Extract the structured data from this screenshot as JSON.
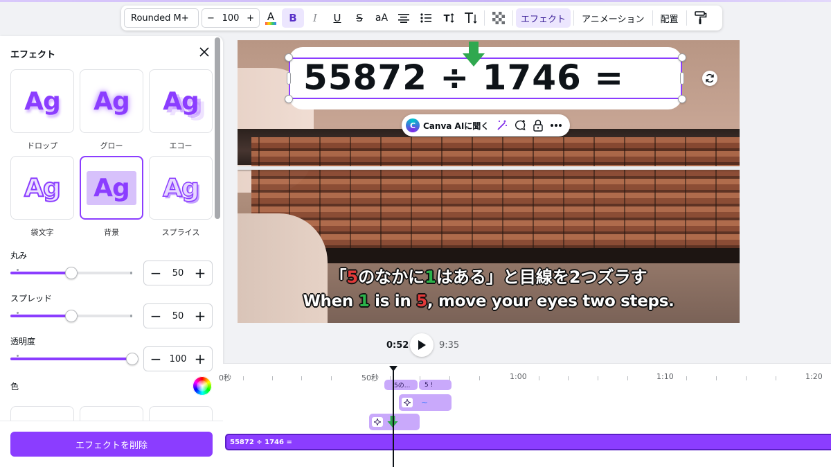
{
  "toolbar": {
    "font_name": "Rounded M+",
    "font_size": "100",
    "minus": "−",
    "plus": "+",
    "bold": "B",
    "italic": "I",
    "underline": "U",
    "strike": "S",
    "case": "aA",
    "effects_label": "エフェクト",
    "animation_label": "アニメーション",
    "position_label": "配置",
    "icons": [
      "text-color-icon",
      "bold-icon",
      "italic-icon",
      "underline-icon",
      "strikethrough-icon",
      "letter-case-icon",
      "align-icon",
      "list-icon",
      "letter-spacing-icon",
      "vertical-text-icon",
      "transparency-icon",
      "paint-roller-icon"
    ],
    "text_color_accent": "#8b3dff"
  },
  "effects_panel": {
    "title": "エフェクト",
    "effects": [
      {
        "label": "ドロップ",
        "sample": "Ag"
      },
      {
        "label": "グロー",
        "sample": "Ag"
      },
      {
        "label": "エコー",
        "sample": "Ag"
      },
      {
        "label": "袋文字",
        "sample": "Ag"
      },
      {
        "label": "背景",
        "sample": "Ag",
        "selected": true
      },
      {
        "label": "スプライス",
        "sample": "Ag"
      }
    ],
    "controls": [
      {
        "label": "丸み",
        "value": "50",
        "fraction": 0.5
      },
      {
        "label": "スプレッド",
        "value": "50",
        "fraction": 0.5
      },
      {
        "label": "透明度",
        "value": "100",
        "fraction": 1.0
      }
    ],
    "color_label": "色",
    "delete_button": "エフェクトを削除",
    "accent_color": "#8b3dff"
  },
  "canvas": {
    "equation": "55872 ÷ 1746 =",
    "subtitle_jp": {
      "open": "「",
      "n1": "5",
      "mid": "のなかに",
      "n2": "1",
      "rest": "はある」と目線を2つズラす"
    },
    "subtitle_en": {
      "a": "When ",
      "n1": "1",
      "b": " is in ",
      "n2": "5",
      "c": ", move your eyes two steps."
    },
    "ai_button": "Canva AIに聞く",
    "ai_logo": "C"
  },
  "playback": {
    "current": "0:52",
    "total": "9:35"
  },
  "timeline": {
    "ruler": [
      "0秒",
      "50秒",
      "1:00",
      "1:10",
      "1:20"
    ],
    "clips": {
      "small_1": "5の...",
      "small_2": "5 !",
      "small_3": "~",
      "main": "55872 ÷ 1746 ="
    }
  }
}
